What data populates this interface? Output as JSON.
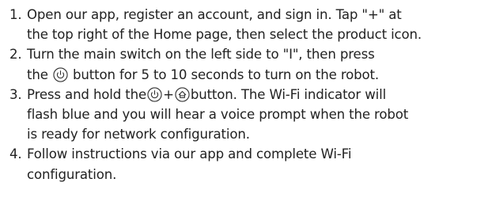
{
  "steps": [
    {
      "number": "1.",
      "line1": "Open our app, register an account, and sign in. Tap \"+\" at",
      "line2": "the top right of the Home page, then select the product icon."
    },
    {
      "number": "2.",
      "line1": "Turn the main switch on the left side to \"I\", then press",
      "line2_before": "the",
      "line2_after": "button for 5 to 10 seconds to turn on the robot.",
      "icon": "power-button-icon"
    },
    {
      "number": "3.",
      "line1_before": "Press and hold the",
      "plus": "+",
      "line1_after": "button. The Wi-Fi indicator will",
      "line2": "flash blue and you will hear a voice prompt when the robot",
      "line3": "is ready for network configuration.",
      "icon_1": "power-button-icon",
      "icon_2": "home-dock-button-icon"
    },
    {
      "number": "4.",
      "line1": "Follow instructions via our app and complete Wi-Fi",
      "line2": "configuration."
    }
  ],
  "colors": {
    "text": "#222222",
    "icon_stroke": "#333333"
  }
}
